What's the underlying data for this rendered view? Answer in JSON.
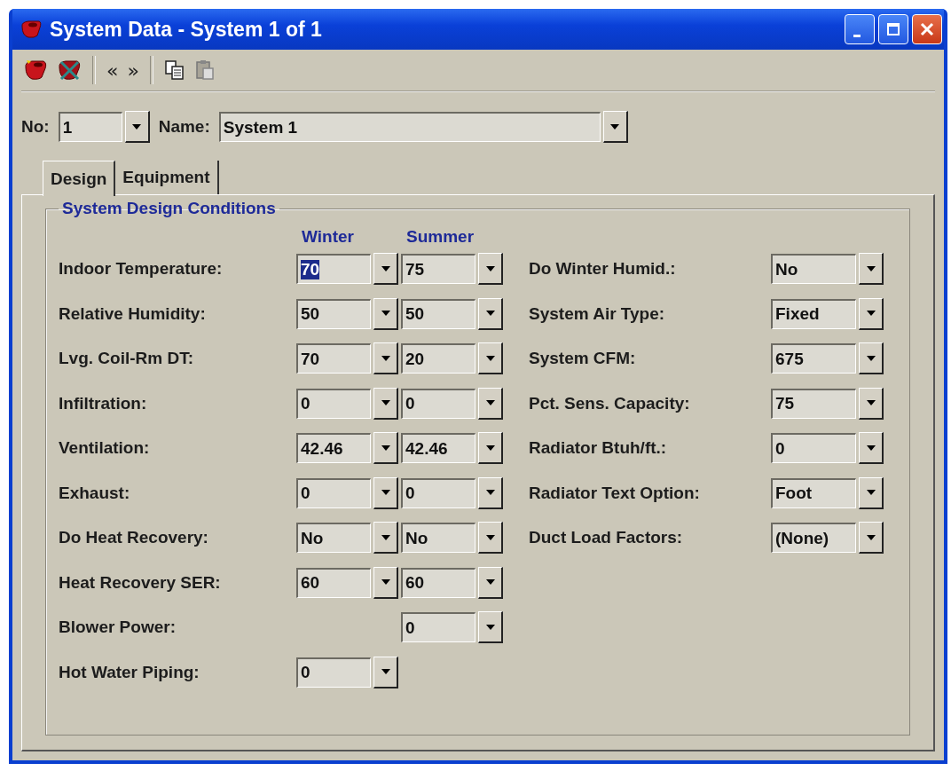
{
  "window": {
    "title": "System Data - System 1 of 1"
  },
  "toolbar": {
    "previous": "«",
    "next": "»",
    "copy": {
      "disabled": false
    },
    "paste": {
      "disabled": true
    }
  },
  "header": {
    "no_label": "No:",
    "no_value": "1",
    "name_label": "Name:",
    "name_value": "System 1"
  },
  "tabs": [
    {
      "label": "Design",
      "selected": true
    },
    {
      "label": "Equipment",
      "selected": false
    }
  ],
  "group": {
    "title": "System Design Conditions",
    "column_headers": [
      "Winter",
      "Summer"
    ],
    "left_rows": [
      {
        "label": "Indoor Temperature:",
        "winter": {
          "value": "70",
          "selected": true
        },
        "summer": {
          "value": "75",
          "selected": false
        }
      },
      {
        "label": "Relative Humidity:",
        "winter": {
          "value": "50",
          "selected": false
        },
        "summer": {
          "value": "50",
          "selected": false
        }
      },
      {
        "label": "Lvg. Coil-Rm DT:",
        "winter": {
          "value": "70",
          "selected": false
        },
        "summer": {
          "value": "20",
          "selected": false
        }
      },
      {
        "label": "Infiltration:",
        "winter": {
          "value": "0",
          "selected": false
        },
        "summer": {
          "value": "0",
          "selected": false
        }
      },
      {
        "label": "Ventilation:",
        "winter": {
          "value": "42.46",
          "selected": false
        },
        "summer": {
          "value": "42.46",
          "selected": false
        }
      },
      {
        "label": "Exhaust:",
        "winter": {
          "value": "0",
          "selected": false
        },
        "summer": {
          "value": "0",
          "selected": false
        }
      },
      {
        "label": "Do Heat Recovery:",
        "winter": {
          "value": "No",
          "selected": false
        },
        "summer": {
          "value": "No",
          "selected": false
        }
      },
      {
        "label": "Heat Recovery SER:",
        "winter": {
          "value": "60",
          "selected": false
        },
        "summer": {
          "value": "60",
          "selected": false
        }
      },
      {
        "label": "Blower Power:",
        "summer": {
          "value": "0",
          "selected": false
        }
      },
      {
        "label": "Hot Water Piping:",
        "winter": {
          "value": "0",
          "selected": false
        }
      }
    ],
    "right_rows": [
      {
        "label": "Do Winter Humid.:",
        "value": "No"
      },
      {
        "label": "System Air Type:",
        "value": "Fixed"
      },
      {
        "label": "System CFM:",
        "value": "675"
      },
      {
        "label": "Pct. Sens. Capacity:",
        "value": "75"
      },
      {
        "label": "Radiator Btuh/ft.:",
        "value": "0"
      },
      {
        "label": "Radiator Text Option:",
        "value": "Foot"
      },
      {
        "label": "Duct Load Factors:",
        "value": "(None)"
      }
    ]
  }
}
